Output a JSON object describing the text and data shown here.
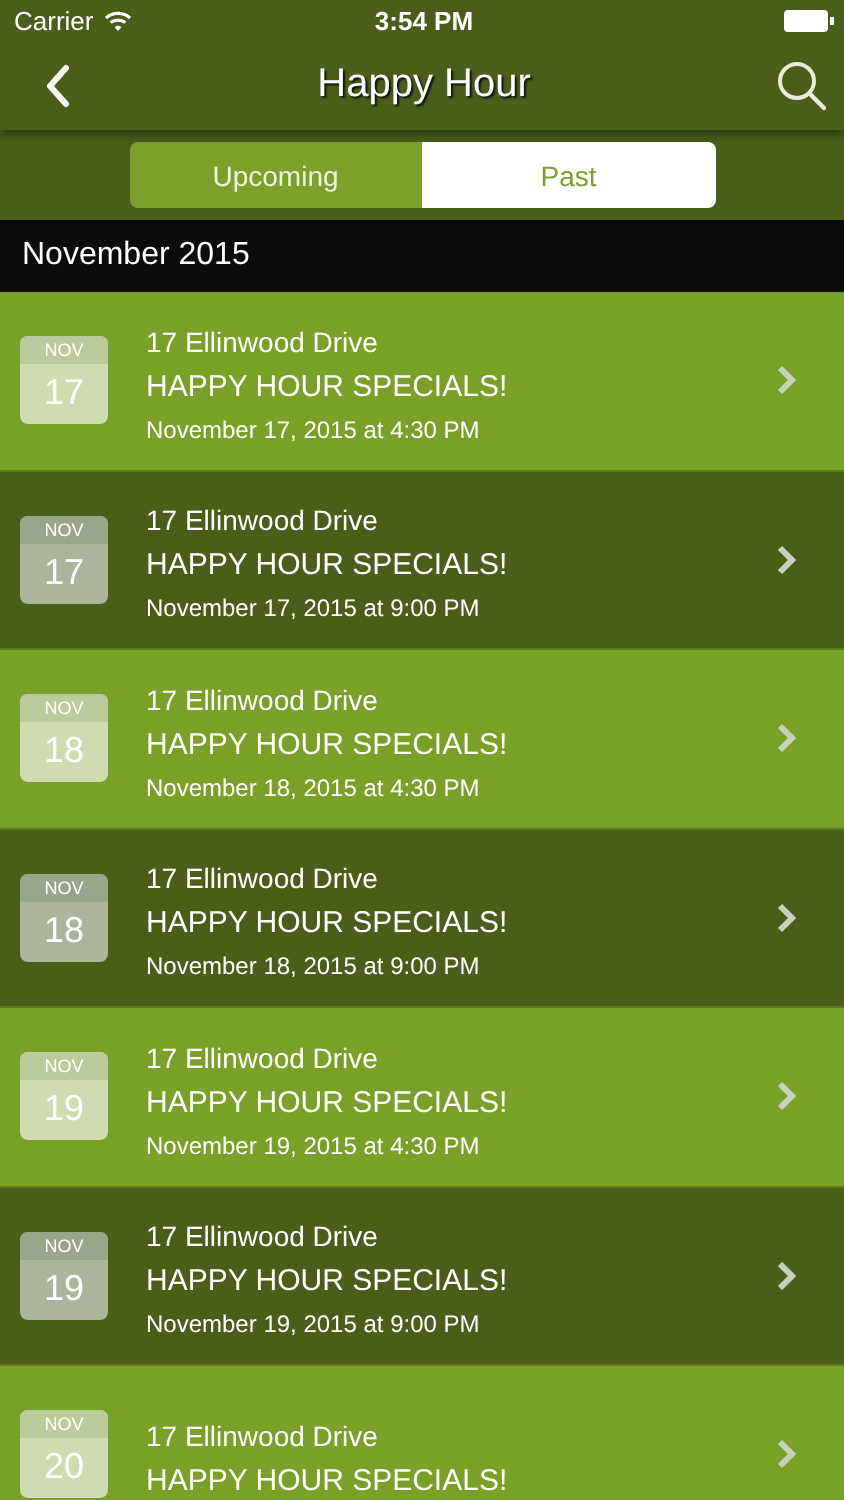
{
  "status_bar": {
    "carrier": "Carrier",
    "time": "3:54 PM"
  },
  "nav": {
    "title": "Happy Hour"
  },
  "tabs": [
    {
      "label": "Upcoming",
      "selected": false
    },
    {
      "label": "Past",
      "selected": true
    }
  ],
  "section": {
    "title": "November 2015"
  },
  "events": [
    {
      "month": "NOV",
      "day": "17",
      "venue": "17 Ellinwood Drive",
      "name": "HAPPY HOUR SPECIALS!",
      "when": "November 17, 2015 at 4:30 PM"
    },
    {
      "month": "NOV",
      "day": "17",
      "venue": "17 Ellinwood Drive",
      "name": "HAPPY HOUR SPECIALS!",
      "when": "November 17, 2015 at 9:00 PM"
    },
    {
      "month": "NOV",
      "day": "18",
      "venue": "17 Ellinwood Drive",
      "name": "HAPPY HOUR SPECIALS!",
      "when": "November 18, 2015 at 4:30 PM"
    },
    {
      "month": "NOV",
      "day": "18",
      "venue": "17 Ellinwood Drive",
      "name": "HAPPY HOUR SPECIALS!",
      "when": "November 18, 2015 at 9:00 PM"
    },
    {
      "month": "NOV",
      "day": "19",
      "venue": "17 Ellinwood Drive",
      "name": "HAPPY HOUR SPECIALS!",
      "when": "November 19, 2015 at 4:30 PM"
    },
    {
      "month": "NOV",
      "day": "19",
      "venue": "17 Ellinwood Drive",
      "name": "HAPPY HOUR SPECIALS!",
      "when": "November 19, 2015 at 9:00 PM"
    },
    {
      "month": "NOV",
      "day": "20",
      "venue": "17 Ellinwood Drive",
      "name": "HAPPY HOUR SPECIALS!"
    }
  ]
}
